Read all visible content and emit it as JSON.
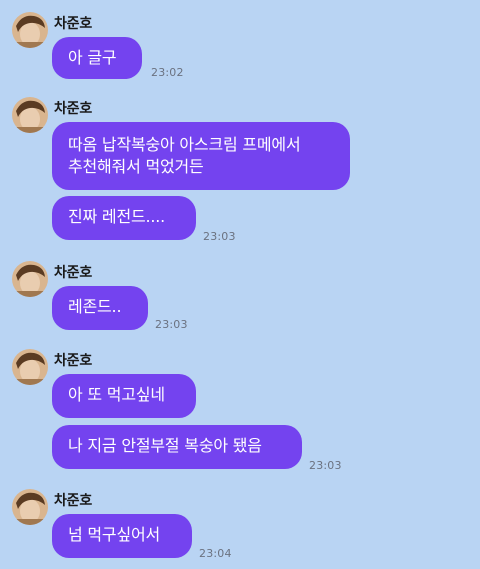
{
  "sender": "차준호",
  "messages": [
    {
      "text": "아 글구",
      "time": "23:02"
    },
    {
      "text": "따옴 납작복숭아 아스크림 프메에서\n추천해줘서 먹었거든",
      "time": ""
    },
    {
      "text": "진짜 레전드....",
      "time": "23:03"
    },
    {
      "text": "레존드..",
      "time": "23:03"
    },
    {
      "text": "아 또 먹고싶네",
      "time": ""
    },
    {
      "text": "나 지금 안절부절 복숭아 됐음",
      "time": "23:03"
    },
    {
      "text": "넘 먹구싶어서",
      "time": "23:04"
    }
  ],
  "colors": {
    "background": "#b9d4f3",
    "bubble": "#7443ef",
    "bubble_text": "#ffffff"
  }
}
